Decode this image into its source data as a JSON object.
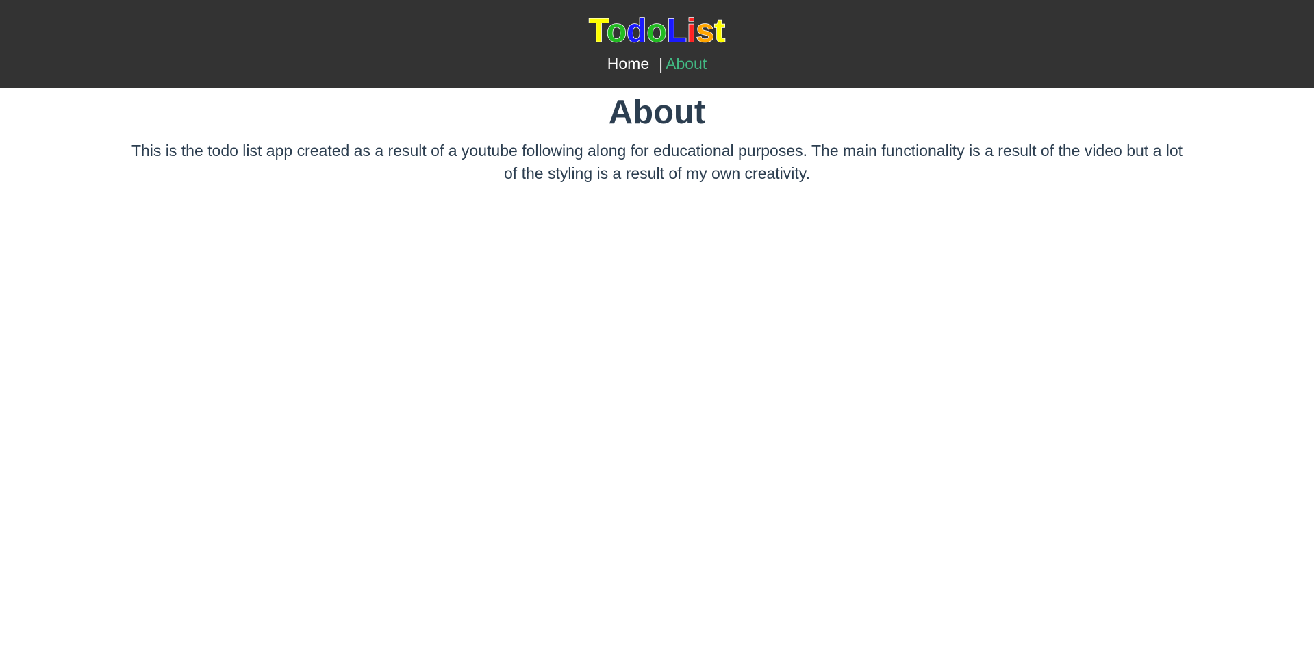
{
  "header": {
    "logo_letters": [
      {
        "char": "T",
        "color": "#ffff00"
      },
      {
        "char": "o",
        "color": "#22bb22"
      },
      {
        "char": "d",
        "color": "#1a1aff"
      },
      {
        "char": "o",
        "color": "#22bb22"
      },
      {
        "char": "L",
        "color": "#1a1aff"
      },
      {
        "char": "i",
        "color": "#ff2222"
      },
      {
        "char": "s",
        "color": "#ffa500"
      },
      {
        "char": "t",
        "color": "#ffff00"
      }
    ],
    "nav": {
      "home_label": "Home",
      "separator": "|",
      "about_label": "About",
      "active": "About",
      "active_color": "#42b983"
    }
  },
  "main": {
    "title": "About",
    "description": "This is the todo list app created as a result of a youtube following along for educational purposes. The main functionality is a result of the video but a lot of the styling is a result of my own creativity."
  }
}
